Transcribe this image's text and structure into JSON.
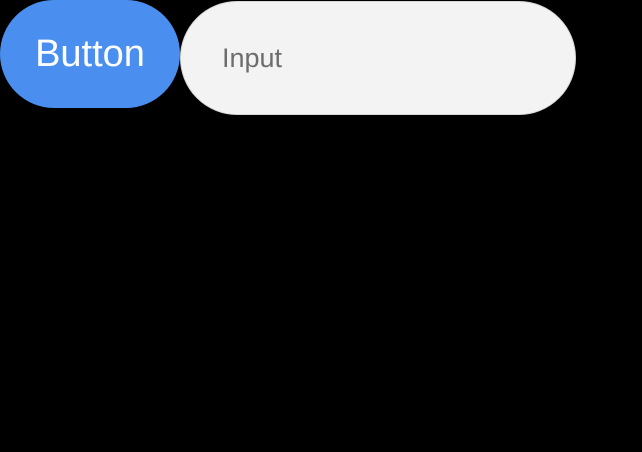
{
  "button": {
    "label": "Button"
  },
  "input": {
    "value": "",
    "placeholder": "Input"
  },
  "colors": {
    "background": "#000000",
    "button_fill": "#4a8ff0",
    "button_text": "#ffffff",
    "input_fill": "#f3f3f3",
    "input_border": "#d6d6d6",
    "placeholder_text": "#6d6d6d"
  }
}
